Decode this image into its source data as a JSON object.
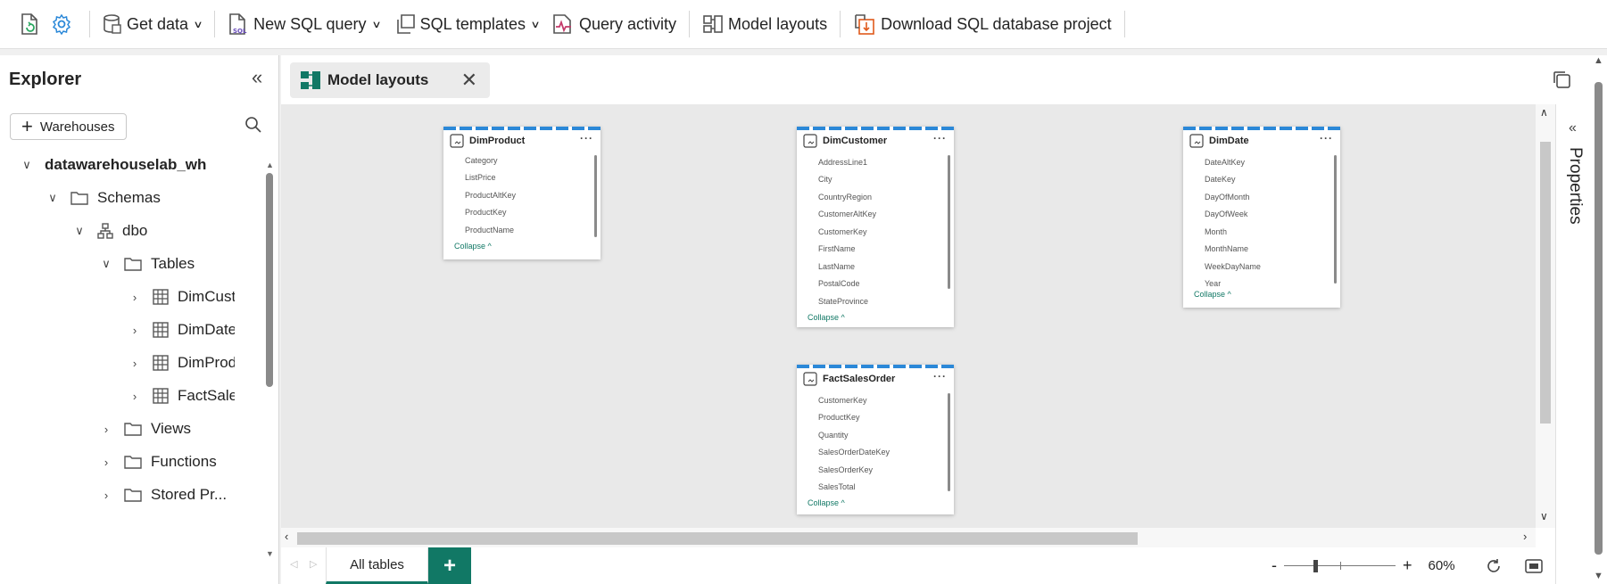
{
  "toolbar": {
    "get_data": "Get data",
    "new_sql_query": "New SQL query",
    "sql_templates": "SQL templates",
    "query_activity": "Query activity",
    "model_layouts": "Model layouts",
    "download_project": "Download SQL database project"
  },
  "explorer": {
    "title": "Explorer",
    "warehouses_button": "Warehouses",
    "tree": {
      "warehouse": "datawarehouselab_wh",
      "schemas": "Schemas",
      "dbo": "dbo",
      "tables": "Tables",
      "table_items": [
        "DimCustomer",
        "DimDate",
        "DimProduct",
        "FactSalesOrder"
      ],
      "views": "Views",
      "functions": "Functions",
      "stored_procedures": "Stored Pr..."
    }
  },
  "main": {
    "tab_label": "Model layouts",
    "properties_label": "Properties",
    "bottom_tab": "All tables",
    "zoom_level": "60%"
  },
  "cards": [
    {
      "name": "DimProduct",
      "columns": [
        "Category",
        "ListPrice",
        "ProductAltKey",
        "ProductKey",
        "ProductName"
      ],
      "collapse": "Collapse"
    },
    {
      "name": "DimCustomer",
      "columns": [
        "AddressLine1",
        "City",
        "CountryRegion",
        "CustomerAltKey",
        "CustomerKey",
        "FirstName",
        "LastName",
        "PostalCode",
        "StateProvince"
      ],
      "collapse": "Collapse"
    },
    {
      "name": "DimDate",
      "columns": [
        "DateAltKey",
        "DateKey",
        "DayOfMonth",
        "DayOfWeek",
        "Month",
        "MonthName",
        "WeekDayName",
        "Year"
      ],
      "collapse": "Collapse"
    },
    {
      "name": "FactSalesOrder",
      "columns": [
        "CustomerKey",
        "ProductKey",
        "Quantity",
        "SalesOrderDateKey",
        "SalesOrderKey",
        "SalesTotal"
      ],
      "collapse": "Collapse"
    }
  ],
  "colors": {
    "accent": "#117865",
    "card_stripe": "#2b88d8"
  }
}
